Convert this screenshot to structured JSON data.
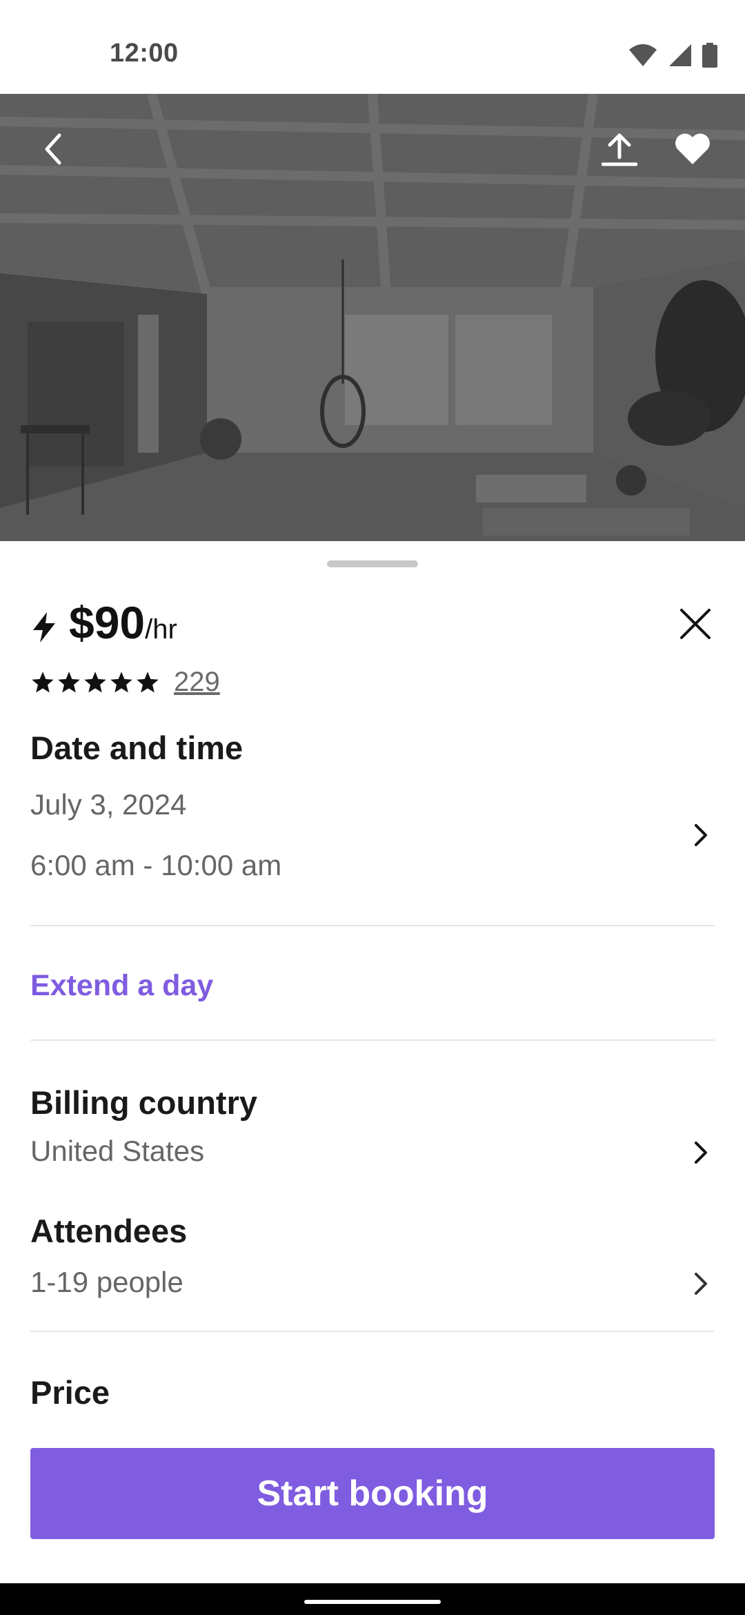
{
  "status_bar": {
    "time": "12:00"
  },
  "listing": {
    "price": "$90",
    "price_unit": "/hr",
    "rating_stars": 5,
    "review_count": "229"
  },
  "date_time": {
    "title": "Date and time",
    "date": "July 3, 2024",
    "time_range": "6:00 am - 10:00 am"
  },
  "extend": {
    "label": "Extend a day"
  },
  "billing": {
    "title": "Billing country",
    "value": "United States"
  },
  "attendees": {
    "title": "Attendees",
    "value": "1-19 people"
  },
  "price_section": {
    "title": "Price"
  },
  "cta": {
    "label": "Start booking"
  },
  "colors": {
    "accent": "#7f5ce0",
    "text": "#1a1a1a",
    "muted": "#666666"
  },
  "icons": [
    "back-icon",
    "share-icon",
    "heart-icon",
    "bolt-icon",
    "close-icon",
    "star-icon",
    "chevron-right-icon"
  ]
}
